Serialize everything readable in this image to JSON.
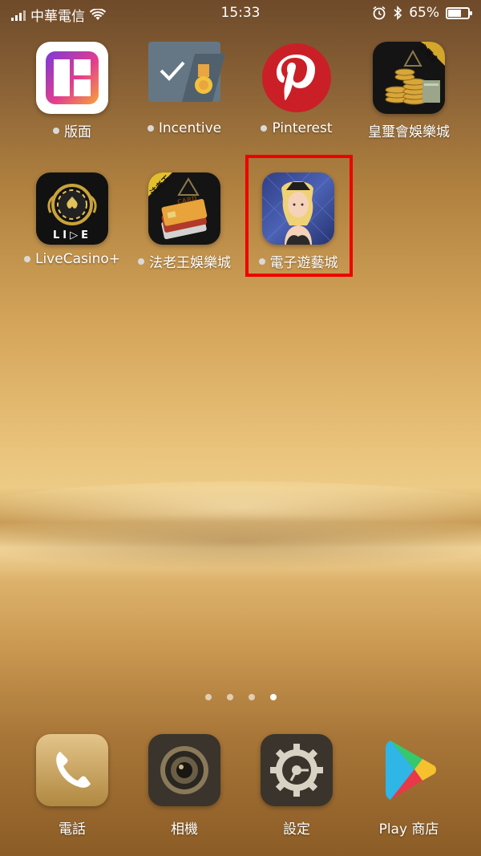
{
  "status": {
    "carrier": "中華電信",
    "time": "15:33",
    "battery": "65%",
    "battery_level": 0.65
  },
  "apps": [
    {
      "label": "版面",
      "icon": "layout-app-icon"
    },
    {
      "label": "Incentive",
      "icon": "incentive-app-icon"
    },
    {
      "label": "Pinterest",
      "icon": "pinterest-app-icon"
    },
    {
      "label": "皇璽會娛樂城",
      "icon": "casino-coins-app-icon"
    },
    {
      "label": "LiveCasino+",
      "icon": "live-casino-app-icon"
    },
    {
      "label": "法老王娛樂城",
      "icon": "pharaoh-casino-app-icon"
    },
    {
      "label": "電子遊藝城",
      "icon": "electronic-casino-app-icon"
    }
  ],
  "badges": {
    "royal": "皇璽會",
    "pharaoh": "法老王",
    "card": "CARD",
    "live": "LI▷E"
  },
  "pager": {
    "count": 4,
    "active_index": 3
  },
  "dock": [
    {
      "label": "電話",
      "icon": "phone-icon"
    },
    {
      "label": "相機",
      "icon": "camera-icon"
    },
    {
      "label": "設定",
      "icon": "settings-gear-icon"
    },
    {
      "label": "Play 商店",
      "icon": "play-store-icon"
    }
  ],
  "colors": {
    "highlight": "#e00000",
    "pinterest": "#cb1f27"
  }
}
